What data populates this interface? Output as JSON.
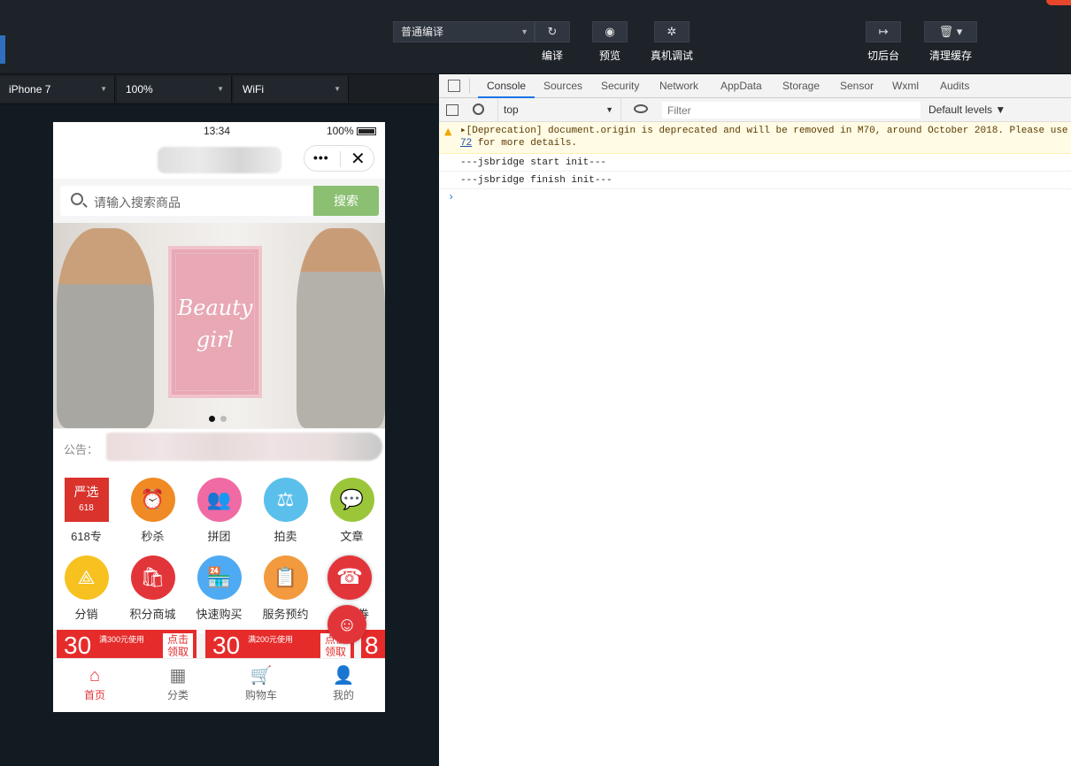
{
  "toolbar": {
    "compile_mode": "普通编译",
    "buttons": [
      {
        "label": "编译",
        "icon": "↻"
      },
      {
        "label": "预览",
        "icon": "◉"
      },
      {
        "label": "真机调试",
        "icon": "✲"
      },
      {
        "label": "切后台",
        "icon": "↦"
      },
      {
        "label": "清理缓存",
        "icon": "🗑"
      }
    ]
  },
  "simulator_bar": {
    "device": "iPhone 7",
    "zoom": "100%",
    "network": "WiFi"
  },
  "phone": {
    "status": {
      "time": "13:34",
      "battery": "100%"
    },
    "search": {
      "placeholder": "请输入搜索商品",
      "button": "搜索"
    },
    "banner": {
      "poster_line1": "Beauty",
      "poster_line2": "girl",
      "page_count": 2,
      "current_page": 1
    },
    "notice": {
      "label": "公告："
    },
    "grid": [
      {
        "label": "618专",
        "icon": "严选",
        "color": "#d9332c"
      },
      {
        "label": "秒杀",
        "icon": "⏰",
        "color": "#f08a24"
      },
      {
        "label": "拼团",
        "icon": "👥",
        "color": "#f06aa4"
      },
      {
        "label": "拍卖",
        "icon": "⚖",
        "color": "#5bbfec"
      },
      {
        "label": "文章",
        "icon": "💬",
        "color": "#9cc63a"
      },
      {
        "label": "分销",
        "icon": "⟁",
        "color": "#f7c21f"
      },
      {
        "label": "积分商城",
        "icon": "🛍",
        "color": "#e2353a"
      },
      {
        "label": "快速购买",
        "icon": "🏪",
        "color": "#4eaaf2"
      },
      {
        "label": "服务预约",
        "icon": "📋",
        "color": "#f29a3d"
      },
      {
        "label": "优惠券",
        "icon": "☎",
        "color": "#e2353a"
      }
    ],
    "coupons": [
      {
        "amount": "30",
        "condition": "满300元使用",
        "action": "点击领取"
      },
      {
        "amount": "30",
        "condition": "满200元使用",
        "action": "点击领取"
      },
      {
        "amount": "8"
      }
    ],
    "tabs": [
      {
        "label": "首页",
        "icon": "⌂"
      },
      {
        "label": "分类",
        "icon": "▦"
      },
      {
        "label": "购物车",
        "icon": "🛒"
      },
      {
        "label": "我的",
        "icon": "👤"
      }
    ]
  },
  "devtools": {
    "tabs": [
      "Console",
      "Sources",
      "Security",
      "Network",
      "AppData",
      "Storage",
      "Sensor",
      "Wxml",
      "Audits"
    ],
    "active_tab": "Console",
    "context": "top",
    "filter_placeholder": "Filter",
    "levels": "Default levels ▼",
    "messages": {
      "warning_line1": "▸[Deprecation] document.origin is deprecated and will be removed in M70, around October 2018. Please use",
      "warning_link": "72",
      "warning_line2": " for more details.",
      "log1": "---jsbridge start init---",
      "log2": "---jsbridge finish init---"
    },
    "prompt": "›"
  }
}
